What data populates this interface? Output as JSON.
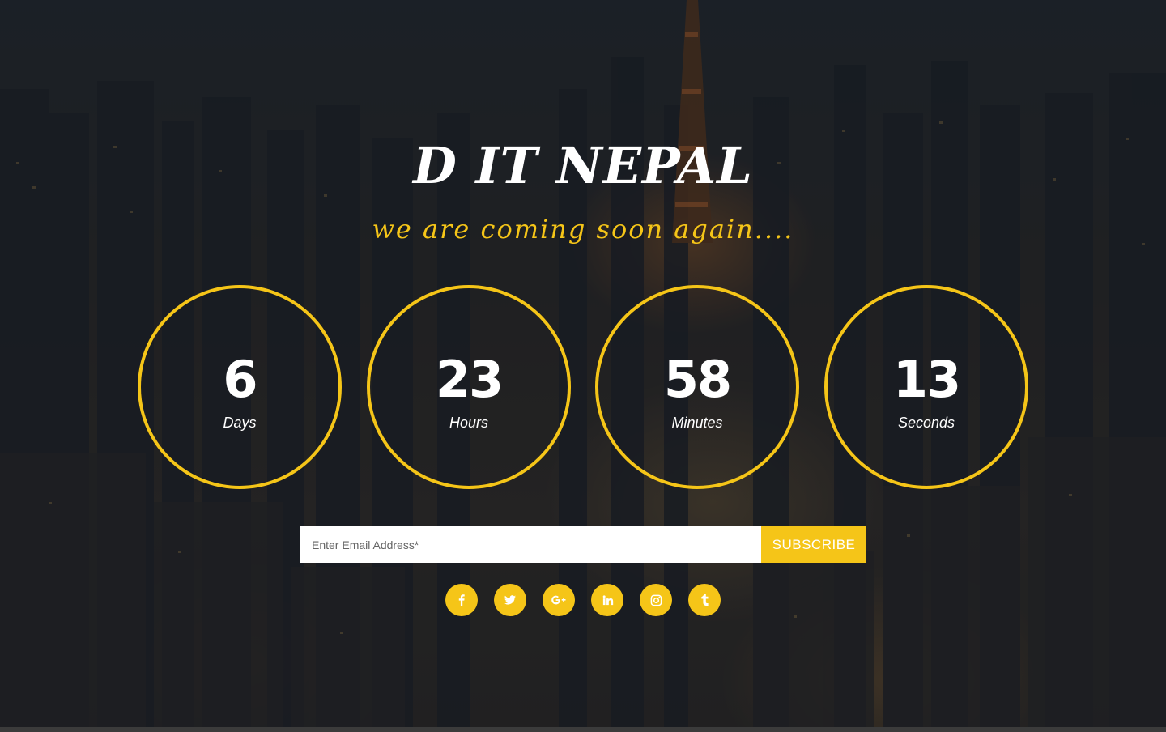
{
  "brand": {
    "title": "D IT NEPAL",
    "tagline": "we are coming soon again....",
    "accent_color": "#f5c518"
  },
  "countdown": [
    {
      "value": "6",
      "unit": "Days"
    },
    {
      "value": "23",
      "unit": "Hours"
    },
    {
      "value": "58",
      "unit": "Minutes"
    },
    {
      "value": "13",
      "unit": "Seconds"
    }
  ],
  "subscribe": {
    "placeholder": "Enter Email Address*",
    "value": "",
    "button_label": "SUBSCRIBE"
  },
  "social": [
    {
      "icon": "facebook-icon"
    },
    {
      "icon": "twitter-icon"
    },
    {
      "icon": "google-plus-icon"
    },
    {
      "icon": "linkedin-icon"
    },
    {
      "icon": "instagram-icon"
    },
    {
      "icon": "tumblr-icon"
    }
  ]
}
